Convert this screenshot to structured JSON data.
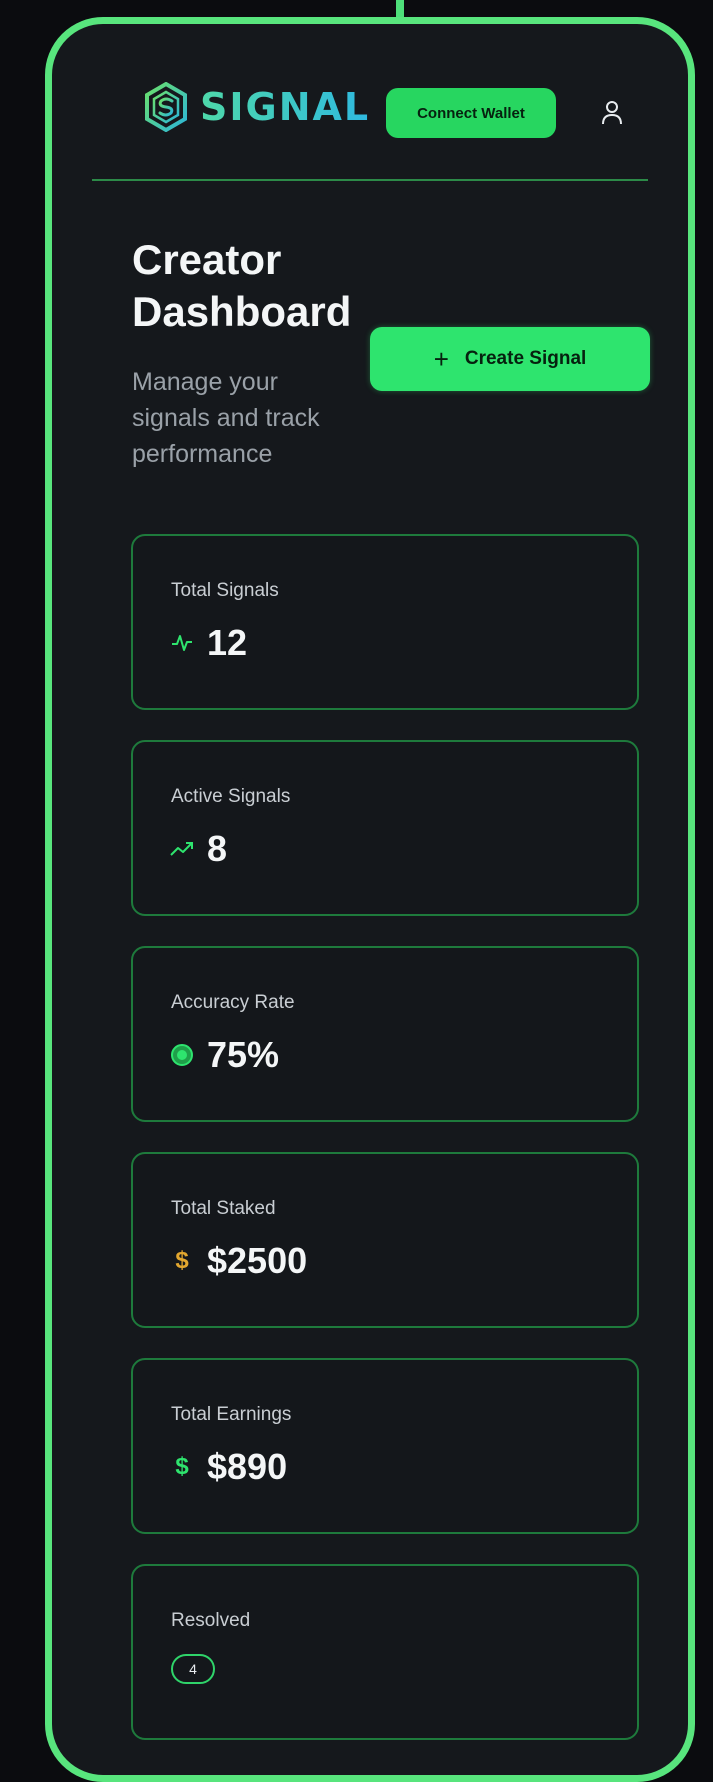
{
  "header": {
    "logo_text": "SIGNAL",
    "connect_label": "Connect Wallet"
  },
  "page": {
    "title_line1": "Creator",
    "title_line2": "Dashboard",
    "subtitle": "Manage your signals and track performance",
    "create_label": "Create Signal"
  },
  "stats": [
    {
      "label": "Total Signals",
      "value": "12",
      "icon": "activity-icon"
    },
    {
      "label": "Active Signals",
      "value": "8",
      "icon": "trending-up-icon"
    },
    {
      "label": "Accuracy Rate",
      "value": "75%",
      "icon": "target-icon"
    },
    {
      "label": "Total Staked",
      "value": "$2500",
      "icon": "dollar-icon"
    },
    {
      "label": "Total Earnings",
      "value": "$890",
      "icon": "dollar-icon"
    }
  ],
  "resolved": {
    "label": "Resolved",
    "count": "4"
  },
  "colors": {
    "accent": "#2ee46e",
    "border": "#58e57d",
    "staked_icon": "#e3a72f",
    "earnings_icon": "#2ee46e"
  }
}
